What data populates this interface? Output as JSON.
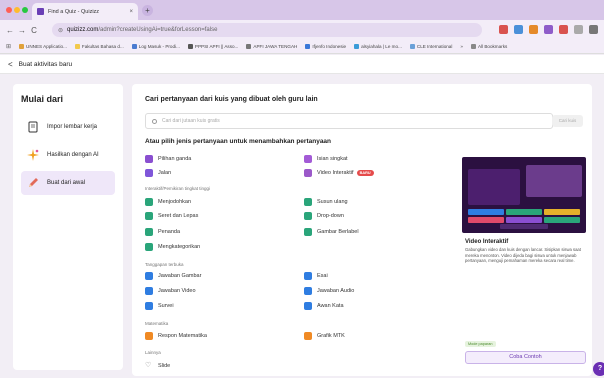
{
  "browser": {
    "tab_title": "Find a Quiz - Quizizz",
    "tab_close": "×",
    "new_tab": "+",
    "nav": {
      "back": "←",
      "forward": "→",
      "reload": "C"
    },
    "url_host": "quizizz.com",
    "url_path": "/admin?createUsingAi=true&forLesson=false",
    "bookmarks": [
      {
        "label": "UNNES Applicatio...",
        "color": "#e0a13a"
      },
      {
        "label": "Fakultas Bahasa d...",
        "color": "#f2c94c"
      },
      {
        "label": "Log Masuk - Prodi...",
        "color": "#4a7bd0"
      },
      {
        "label": "PPPSI APFI || Asso...",
        "color": "#555555"
      },
      {
        "label": "APFI JAWA TENGAH",
        "color": "#777777"
      },
      {
        "label": "Ifjenfo Indonesie",
        "color": "#3a78d8"
      },
      {
        "label": "alsyiahala | Le mo...",
        "color": "#3a9bd8"
      },
      {
        "label": "CLE International",
        "color": "#6aa0d8"
      },
      {
        "label": "»",
        "color": ""
      },
      {
        "label": "All Bookmarks",
        "color": "#888888"
      }
    ]
  },
  "appbar": {
    "back": "<",
    "title": "Buat aktivitas baru"
  },
  "left": {
    "title": "Mulai dari",
    "options": [
      {
        "label": "Impor lembar kerja",
        "icon": "document-icon"
      },
      {
        "label": "Hasilkan dengan AI",
        "icon": "sparkle-icon"
      },
      {
        "label": "Buat dari awal",
        "icon": "pencil-icon"
      }
    ]
  },
  "main": {
    "heading1": "Cari pertanyaan dari kuis yang dibuat oleh guru lain",
    "search_placeholder": "Cari dari jutaan kuis gratis",
    "search_button": "Cari kuis",
    "heading2": "Atau pilih jenis pertanyaan untuk menambahkan pertanyaan",
    "sections": {
      "interaktif": "Interaktif/Pemikiran tingkat tinggi",
      "terbuka": "Tanggapan terbuka",
      "matematika": "Matematika",
      "lainnya": "Lainnya"
    },
    "types": {
      "pilihan_ganda": {
        "label": "Pilihan ganda",
        "color": "#8a4fd0"
      },
      "isian_singkat": {
        "label": "Isian singkat",
        "color": "#a35bd6"
      },
      "jalan": {
        "label": "Jalan",
        "color": "#7f56d9"
      },
      "video_interaktif": {
        "label": "Video Interaktif",
        "color": "#9b59c9",
        "badge": "BARU"
      },
      "menjodohkan": {
        "label": "Menjodohkan",
        "color": "#2aa57a"
      },
      "susun_ulang": {
        "label": "Susun ulang",
        "color": "#2aa57a"
      },
      "seret_lepas": {
        "label": "Seret dan Lepas",
        "color": "#2aa57a"
      },
      "drop_down": {
        "label": "Drop-down",
        "color": "#2aa57a"
      },
      "penanda": {
        "label": "Penanda",
        "color": "#2aa57a"
      },
      "gambar_berlabel": {
        "label": "Gambar Berlabel",
        "color": "#2aa57a"
      },
      "mengkategorikan": {
        "label": "Mengkategorikan",
        "color": "#2aa57a"
      },
      "jawaban_gambar": {
        "label": "Jawaban Gambar",
        "color": "#2f7de1"
      },
      "esai": {
        "label": "Esai",
        "color": "#2f7de1"
      },
      "jawaban_video": {
        "label": "Jawaban Video",
        "color": "#2f7de1"
      },
      "jawaban_audio": {
        "label": "Jawaban Audio",
        "color": "#2f7de1"
      },
      "survei": {
        "label": "Survei",
        "color": "#2f7de1"
      },
      "awan_kata": {
        "label": "Awan Kata",
        "color": "#2f7de1"
      },
      "respon_matematika": {
        "label": "Respon Matematika",
        "color": "#f08a24"
      },
      "grafik_mtk": {
        "label": "Grafik MTK",
        "color": "#f08a24"
      },
      "slide": {
        "label": "Slide",
        "color": "#888888"
      }
    }
  },
  "preview": {
    "title": "Video Interaktif",
    "description": "Gabungkan video dan kuis dengan lancar. Sisipkan siswa saat mereka menonton. Video dijeda bagi siswa untuk menjawab pertanyaan, menguji pemahaman mereka secara real time.",
    "badge": "Mode paparan",
    "button": "Coba Contoh",
    "help": "?"
  }
}
